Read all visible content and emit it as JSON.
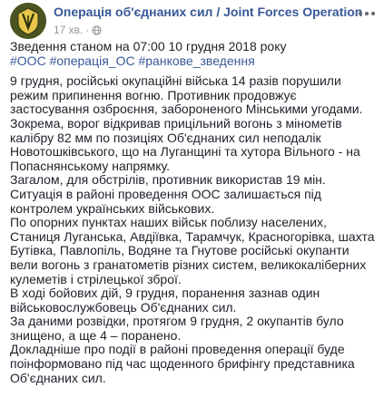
{
  "post": {
    "page_name": "Операція об'єднаних сил / Joint Forces Operation",
    "timestamp": "17 хв.",
    "avatar_icon": "joint-forces-emblem-icon",
    "privacy_icon": "globe-icon",
    "more_icon": "more-options-icon",
    "title_line": "Зведення станом на 07:00 10 грудня 2018 року",
    "hashtags": [
      "#ООС",
      "#операція_ОС",
      "#ранкове_зведення"
    ],
    "paragraphs": [
      "9 грудня, російські окупаційні війська 14 разів порушили режим припинення вогню. Противник продовжує застосування озброєння, забороненого Мінськими угодами.",
      "Зокрема, ворог відкривав прицільний вогонь з мінометів калібру 82 мм по позиціях Об'єднаних сил неподалік Новотошківського, що на Луганщині та хутора Вільного - на Попаснянському напрямку.",
      "Загалом, для обстрілів, противник використав 19 мін.",
      "Ситуація в районі проведення ООС залишається під контролем українських військових.",
      "По опорних пунктах наших військ поблизу населених, Станиця Луганська, Авдіївка, Тарамчук, Красногорівка, шахта Бутівка, Павлопіль, Водяне та Гнутове російські окупанти вели вогонь з гранатометів різних систем, великокаліберних кулеметів і стрілецької зброї.",
      "В ході бойових дій, 9 грудня, поранення зазнав один військовослужбовець Об'єднаних сил.",
      "За даними розвідки, протягом 9 грудня, 2 окупантів було знищено, а ще 4 – поранено.",
      "Докладніше про події в районі проведення операції буде поінформовано під час щоденного брифінгу представника Об'єднаних сил."
    ]
  },
  "colors": {
    "link": "#385898",
    "text": "#1d2129",
    "meta": "#90949c",
    "avatar_bg": "#4b5320"
  }
}
